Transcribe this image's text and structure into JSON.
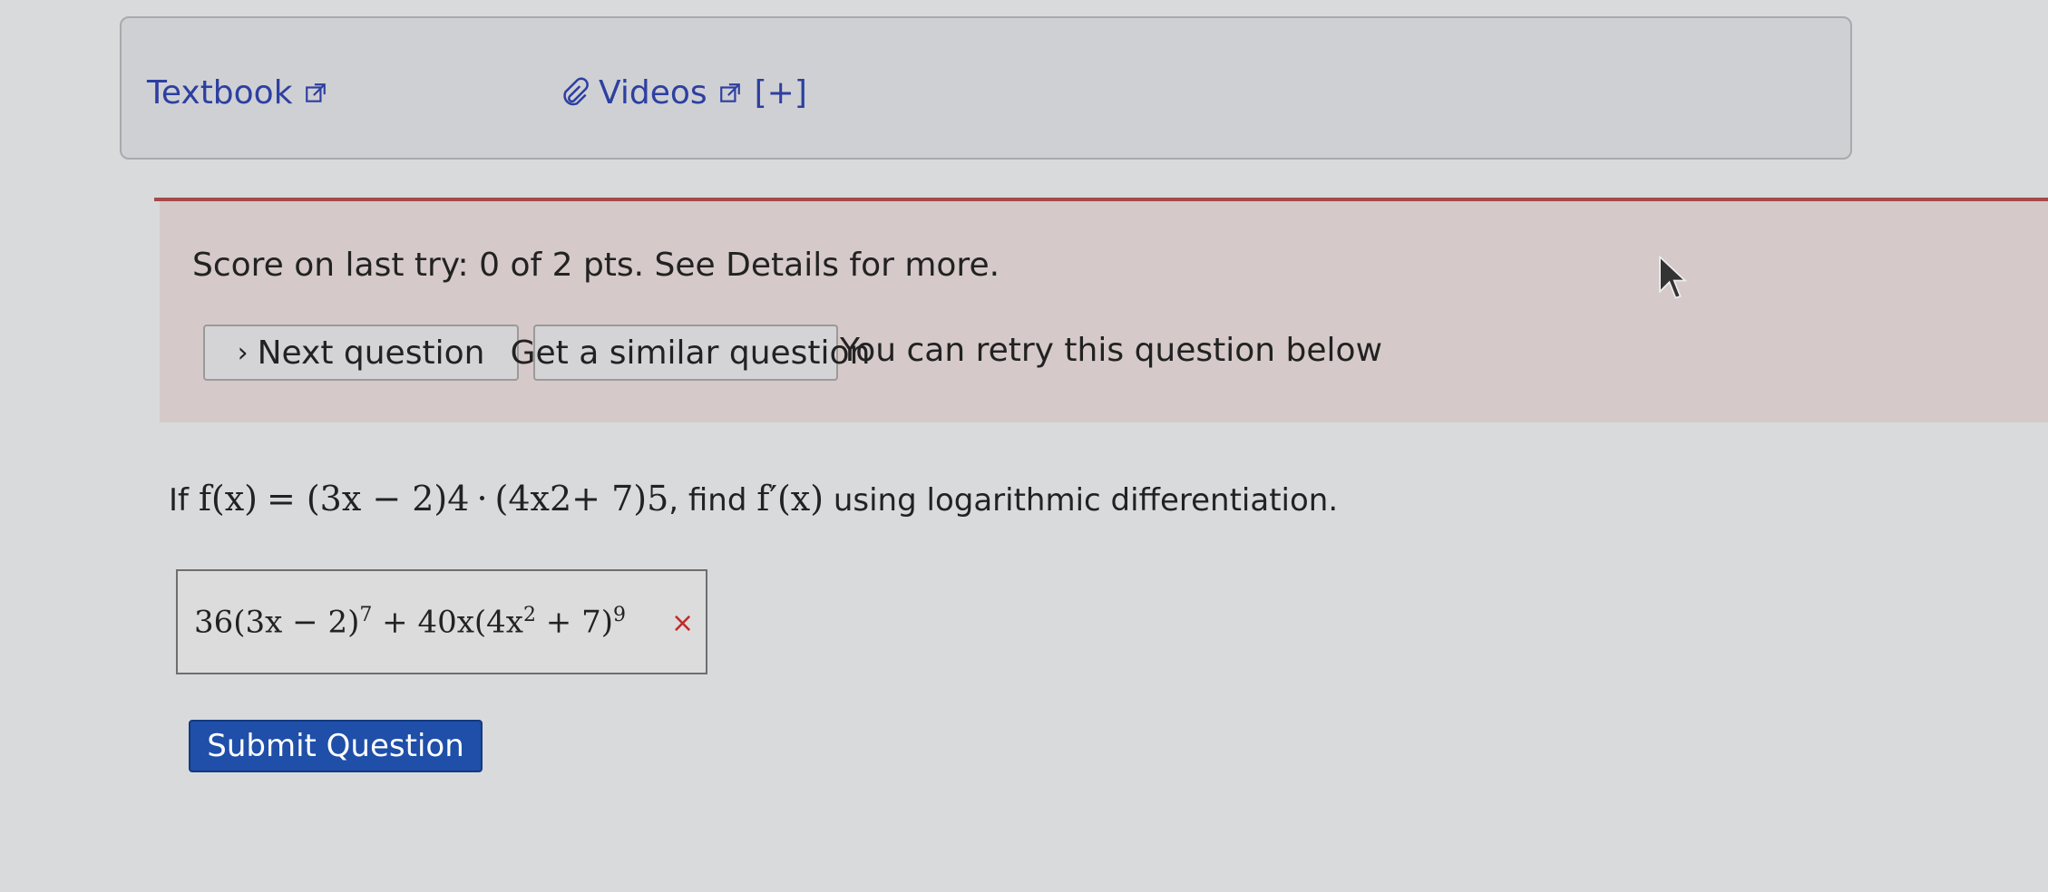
{
  "help": {
    "textbook_label": "Textbook",
    "videos_label": "Videos",
    "plus_label": "[+]"
  },
  "score": {
    "text": "Score on last try: 0 of 2 pts. See Details for more.",
    "next_label": "Next question",
    "similar_label": "Get a similar question",
    "retry_text": "You can retry this question below"
  },
  "question": {
    "prefix": "If",
    "lhs": "f(x)",
    "equals": "=",
    "rhs_a": "(3x − 2)",
    "exp_a": "4",
    "dot": "·",
    "rhs_b": "(4x",
    "exp_b_inner": "2",
    "rhs_b2": " + 7)",
    "exp_b": "5",
    "middle": ", find",
    "target": "f′(x)",
    "suffix": "using logarithmic differentiation."
  },
  "answer": {
    "part1": "36(3x − 2)",
    "exp1": "7",
    "part2": " + 40x(4x",
    "exp2": "2",
    "part3": " + 7)",
    "exp3": "9",
    "status_icon": "×"
  },
  "submit_label": "Submit Question",
  "colors": {
    "link": "#2d3fa0",
    "submit_bg": "#1f4fa8",
    "error": "#c02a2a",
    "score_panel": "#d5c9c9",
    "divider": "#a44a4a"
  }
}
